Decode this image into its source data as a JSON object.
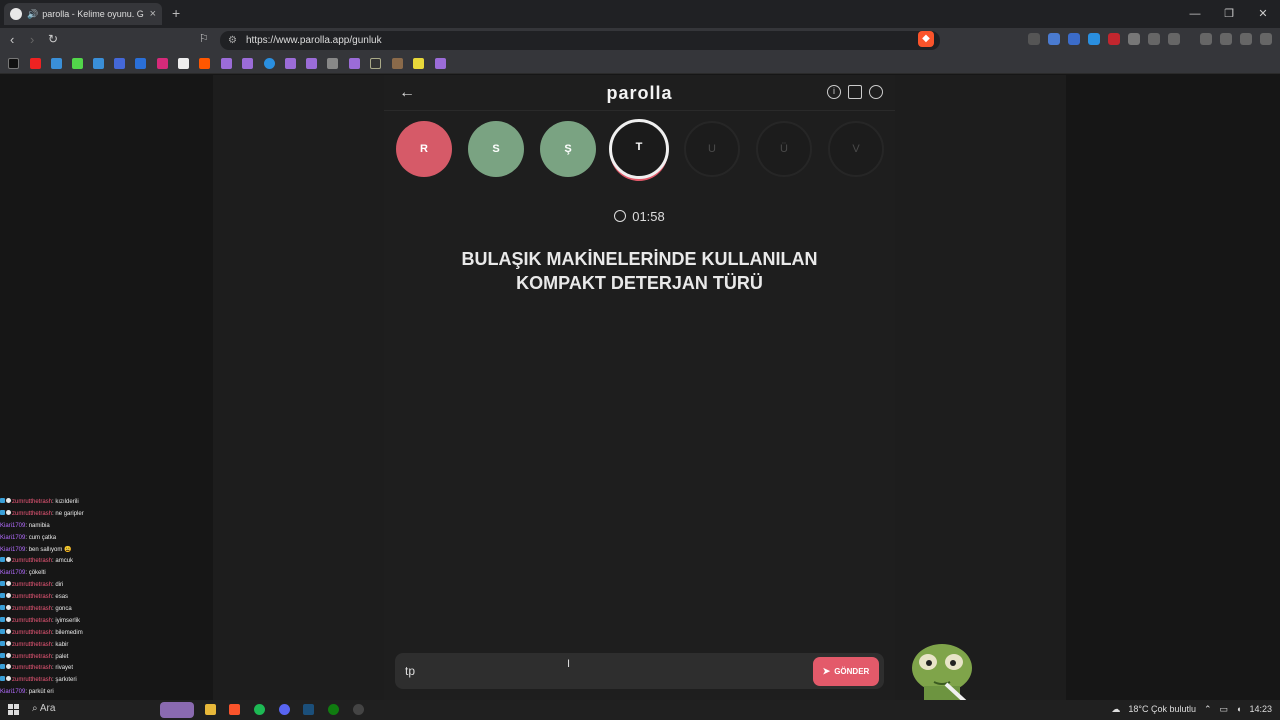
{
  "browser": {
    "tab_title": "parolla - Kelime oyunu. Günlük",
    "new_tab": "+",
    "tab_close": "×",
    "url": "https://www.parolla.app/gunluk",
    "window_controls": [
      "—",
      "❐",
      "✕"
    ]
  },
  "app": {
    "logo": "parolla",
    "back_label": "←",
    "letters": [
      {
        "char": "R",
        "state": "wrong"
      },
      {
        "char": "S",
        "state": "correct"
      },
      {
        "char": "Ş",
        "state": "correct"
      },
      {
        "char": "T",
        "state": "active"
      },
      {
        "char": "U",
        "state": "pending"
      },
      {
        "char": "Ü",
        "state": "pending"
      },
      {
        "char": "V",
        "state": "pending"
      }
    ],
    "timer": "01:58",
    "question": "BULAŞIK MAKİNELERİNDE KULLANILAN KOMPAKT DETERJAN TÜRÜ",
    "answer_value": "tp",
    "send_label": "GÖNDER"
  },
  "chat": [
    {
      "user": "zumrutthetrash",
      "msg": "kızılderili",
      "color": "#f0597a"
    },
    {
      "user": "zumrutthetrash",
      "msg": "ne garipler",
      "color": "#f0597a"
    },
    {
      "user": "Kiari1709",
      "msg": "namibia",
      "color": "#b36cff"
    },
    {
      "user": "Kiari1709",
      "msg": "cum çatka",
      "color": "#b36cff"
    },
    {
      "user": "Kiari1709",
      "msg": "ben sallıyom 😩",
      "color": "#b36cff"
    },
    {
      "user": "zumrutthetrash",
      "msg": "amcuk",
      "color": "#f0597a"
    },
    {
      "user": "Kiari1709",
      "msg": "çökelti",
      "color": "#b36cff"
    },
    {
      "user": "zumrutthetrash",
      "msg": "diri",
      "color": "#f0597a"
    },
    {
      "user": "zumrutthetrash",
      "msg": "esas",
      "color": "#f0597a"
    },
    {
      "user": "zumrutthetrash",
      "msg": "gonca",
      "color": "#f0597a"
    },
    {
      "user": "zumrutthetrash",
      "msg": "iyimserlik",
      "color": "#f0597a"
    },
    {
      "user": "zumrutthetrash",
      "msg": "bilemedim",
      "color": "#f0597a"
    },
    {
      "user": "zumrutthetrash",
      "msg": "kabir",
      "color": "#f0597a"
    },
    {
      "user": "zumrutthetrash",
      "msg": "palet",
      "color": "#f0597a"
    },
    {
      "user": "zumrutthetrash",
      "msg": "rivayet",
      "color": "#f0597a"
    },
    {
      "user": "zumrutthetrash",
      "msg": "şarkıteri",
      "color": "#f0597a"
    },
    {
      "user": "Kiari1709",
      "msg": "parküt eri",
      "color": "#b36cff"
    }
  ],
  "taskbar": {
    "search_label": "Ara",
    "weather": "18°C  Çok bulutlu",
    "time": "14:23"
  },
  "colors": {
    "wrong": "#d65a68",
    "correct": "#7aa382",
    "accent": "#e35a6a"
  }
}
